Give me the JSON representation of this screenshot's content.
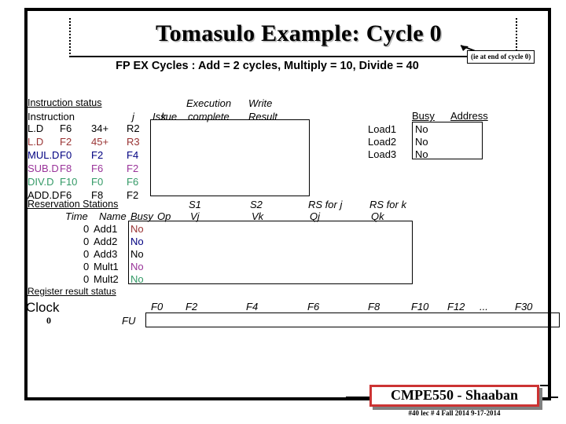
{
  "slide": {
    "title": "Tomasulo Example:  Cycle 0",
    "subtitle": "FP EX Cycles :  Add = 2 cycles, Multiply = 10, Divide = 40",
    "callout": "(ie at end of cycle 0)"
  },
  "colors": {
    "black": "#000000",
    "maroon": "#993333",
    "navy": "#000080",
    "magenta": "#993399",
    "green": "#339966",
    "footer_red": "#cc3333",
    "footer_shadow": "#808080"
  },
  "instruction_status": {
    "section_label": "Instruction status",
    "headers": {
      "instruction": "Instruction",
      "j": "j",
      "k": "k",
      "issue": "Issue",
      "execution": "Execution",
      "complete": "complete",
      "write": "Write",
      "result": "Result"
    },
    "rows": [
      {
        "op": "L.D",
        "dest": "F6",
        "j": "34+",
        "k": "R2",
        "color": "#000000",
        "issue": "",
        "exec": "",
        "write": ""
      },
      {
        "op": "L.D",
        "dest": "F2",
        "j": "45+",
        "k": "R3",
        "color": "#993333",
        "issue": "",
        "exec": "",
        "write": ""
      },
      {
        "op": "MUL.D",
        "dest": "F0",
        "j": "F2",
        "k": "F4",
        "color": "#000080",
        "issue": "",
        "exec": "",
        "write": ""
      },
      {
        "op": "SUB.D",
        "dest": "F8",
        "j": "F6",
        "k": "F2",
        "color": "#993399",
        "issue": "",
        "exec": "",
        "write": ""
      },
      {
        "op": "DIV.D",
        "dest": "F10",
        "j": "F0",
        "k": "F6",
        "color": "#339966",
        "issue": "",
        "exec": "",
        "write": ""
      },
      {
        "op": "ADD.D",
        "dest": "F6",
        "j": "F8",
        "k": "F2",
        "color": "#000000",
        "issue": "",
        "exec": "",
        "write": ""
      }
    ]
  },
  "load_buffers": {
    "headers": {
      "busy": "Busy",
      "address": "Address"
    },
    "rows": [
      {
        "name": "Load1",
        "busy": "No",
        "address": ""
      },
      {
        "name": "Load2",
        "busy": "No",
        "address": ""
      },
      {
        "name": "Load3",
        "busy": "No",
        "address": ""
      }
    ]
  },
  "reservation_stations": {
    "section_label": "Reservation Stations",
    "headers": {
      "time": "Time",
      "name": "Name",
      "busy": "Busy",
      "op": "Op",
      "s1": "S1",
      "vj": "Vj",
      "s2": "S2",
      "vk": "Vk",
      "rs_for_j": "RS for j",
      "qj": "Qj",
      "rs_for_k": "RS for k",
      "qk": "Qk"
    },
    "rows": [
      {
        "time": "0",
        "name": "Add1",
        "busy": "No",
        "color": "#993333",
        "op": "",
        "vj": "",
        "vk": "",
        "qj": "",
        "qk": ""
      },
      {
        "time": "0",
        "name": "Add2",
        "busy": "No",
        "color": "#000080",
        "op": "",
        "vj": "",
        "vk": "",
        "qj": "",
        "qk": ""
      },
      {
        "time": "0",
        "name": "Add3",
        "busy": "No",
        "color": "#000000",
        "op": "",
        "vj": "",
        "vk": "",
        "qj": "",
        "qk": ""
      },
      {
        "time": "0",
        "name": "Mult1",
        "busy": "No",
        "color": "#993399",
        "op": "",
        "vj": "",
        "vk": "",
        "qj": "",
        "qk": ""
      },
      {
        "time": "0",
        "name": "Mult2",
        "busy": "No",
        "color": "#339966",
        "op": "",
        "vj": "",
        "vk": "",
        "qj": "",
        "qk": ""
      }
    ]
  },
  "register_result_status": {
    "section_label": "Register result status",
    "clock_label": "Clock",
    "clock_value": "0",
    "fu_label": "FU",
    "registers": [
      "F0",
      "F2",
      "F4",
      "F6",
      "F8",
      "F10",
      "F12",
      "...",
      "F30"
    ],
    "values": [
      "",
      "",
      "",
      "",
      "",
      "",
      "",
      "",
      ""
    ]
  },
  "footer": {
    "course": "CMPE550 - Shaaban",
    "meta": "#40   lec # 4 Fall 2014   9-17-2014"
  }
}
